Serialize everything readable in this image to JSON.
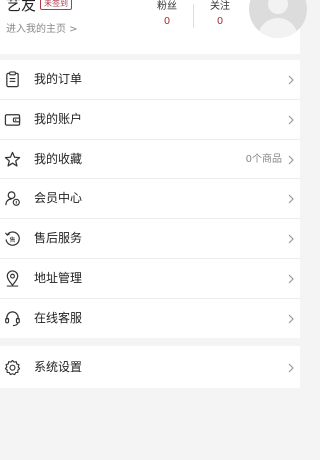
{
  "profile": {
    "username": "艺友",
    "badge": "未签到",
    "homepage_link": "进入我的主页 >",
    "fans_label": "粉丝",
    "fans_count": "0",
    "follow_label": "关注",
    "follow_count": "0"
  },
  "menu": {
    "items": [
      {
        "label": "我的订单",
        "icon": "clipboard-icon"
      },
      {
        "label": "我的账户",
        "icon": "wallet-icon"
      },
      {
        "label": "我的收藏",
        "icon": "star-icon",
        "extra": "0个商品"
      },
      {
        "label": "会员中心",
        "icon": "member-icon"
      },
      {
        "label": "售后服务",
        "icon": "after-sales-icon"
      },
      {
        "label": "地址管理",
        "icon": "location-pin-icon"
      },
      {
        "label": "在线客服",
        "icon": "headset-icon"
      }
    ],
    "settings": {
      "label": "系统设置",
      "icon": "gear-icon"
    }
  },
  "colors": {
    "accent": "#a8313f",
    "badge_border": "#b03a4a",
    "background": "#f4f4f4"
  }
}
